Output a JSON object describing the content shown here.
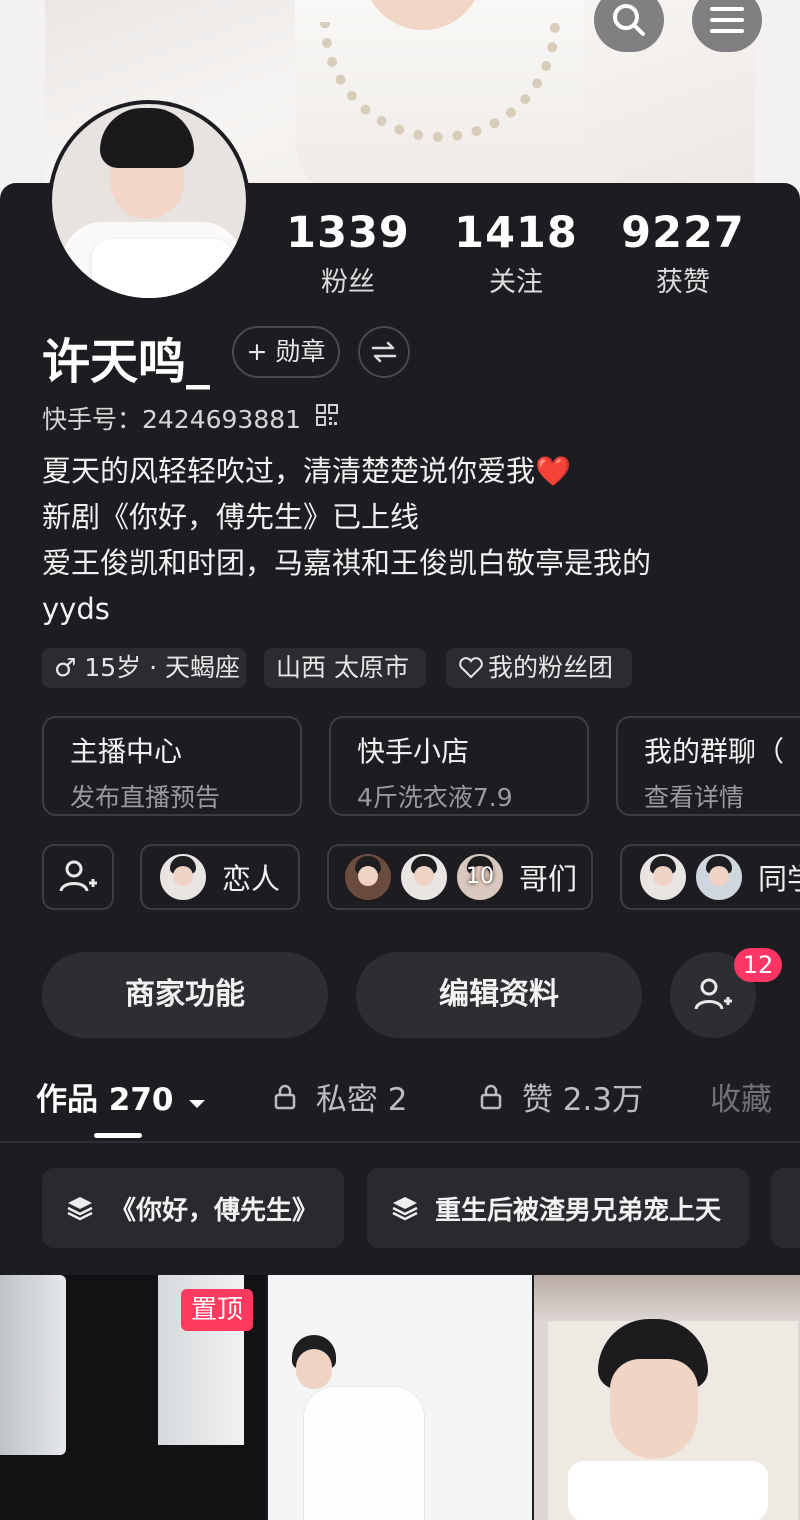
{
  "header": {
    "search_icon": "search-icon",
    "menu_icon": "menu-icon"
  },
  "profile": {
    "stats": [
      {
        "value": "1339",
        "label": "粉丝"
      },
      {
        "value": "1418",
        "label": "关注"
      },
      {
        "value": "9227",
        "label": "获赞"
      }
    ],
    "name": "许天鸣_",
    "badge_label": "+ 勋章",
    "kuaishou_id": "快手号：2424693881",
    "bio": [
      "夏天的风轻轻吹过，清清楚楚说你爱我❤️",
      "新剧《你好，傅先生》已上线",
      "爱王俊凯和时团，马嘉祺和王俊凯白敬亭是我的",
      "yyds"
    ],
    "tags": {
      "age": "♂ 15岁 · 天蝎座",
      "location": "山西 太原市",
      "fan_club": "我的粉丝团"
    }
  },
  "cards": [
    {
      "title": "主播中心",
      "subtitle": "发布直播预告"
    },
    {
      "title": "快手小店",
      "subtitle": "4斤洗衣液7.9"
    },
    {
      "title": "我的群聊（",
      "subtitle": "查看详情"
    }
  ],
  "groups": {
    "lover": "恋人",
    "bros": "哥们",
    "bros_count": "10",
    "classmates": "同学"
  },
  "actions": {
    "merchant": "商家功能",
    "edit_profile": "编辑资料",
    "notification_count": "12"
  },
  "tabs": {
    "works": "作品 270",
    "private": "私密 2",
    "likes": "赞 2.3万",
    "favorites": "收藏"
  },
  "collections": [
    "《你好，傅先生》",
    "重生后被渣男兄弟宠上天"
  ],
  "pinned_label": "置顶",
  "colors": {
    "accent": "#fe3666",
    "background": "#1d1c21",
    "card": "#2e2d32"
  }
}
